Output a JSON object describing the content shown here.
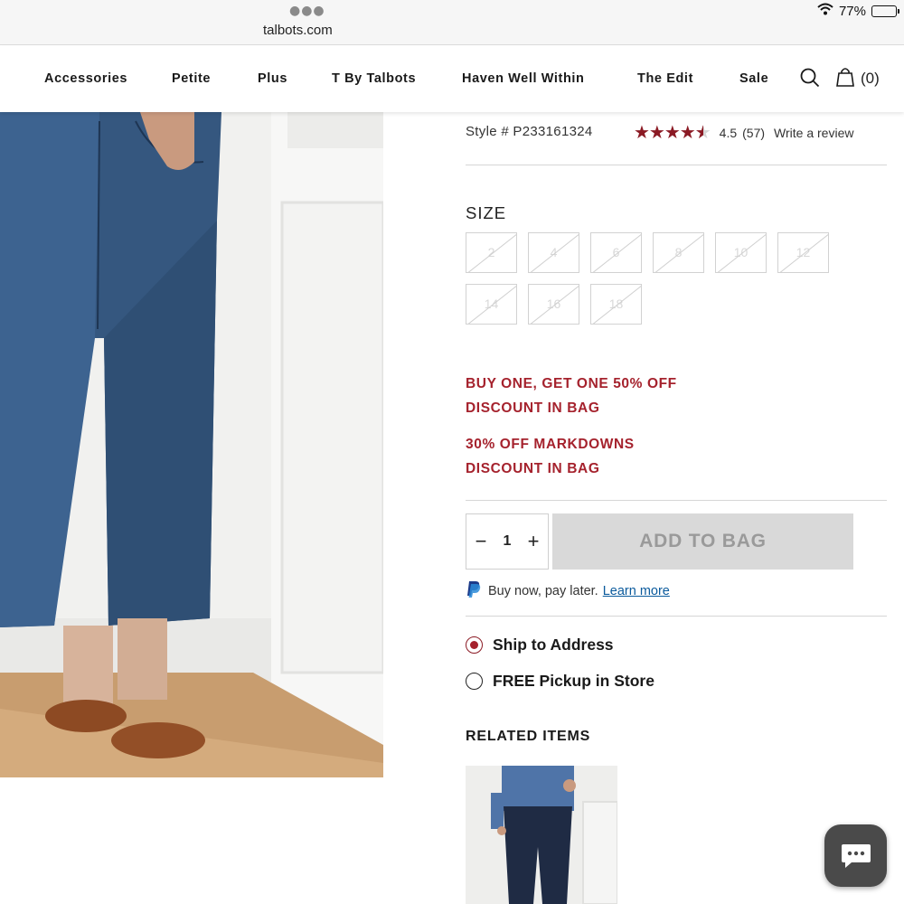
{
  "browser": {
    "url": "talbots.com",
    "battery_percent_label": "77%",
    "battery_level": 0.77
  },
  "nav": {
    "items": [
      "Accessories",
      "Petite",
      "Plus",
      "T By Talbots",
      "Haven Well Within",
      "The Edit",
      "Sale"
    ],
    "bag_count": "(0)"
  },
  "product": {
    "style": "Style # P233161324",
    "rating_value": "4.5",
    "rating_count": "(57)",
    "write_review": "Write a review",
    "stars_filled": 4.5,
    "size_label": "SIZE",
    "sizes": [
      "2",
      "4",
      "6",
      "8",
      "10",
      "12",
      "14",
      "16",
      "18"
    ],
    "sizes_available": false,
    "promos": [
      {
        "line1": "BUY ONE, GET ONE 50% OFF",
        "line2": "DISCOUNT IN BAG"
      },
      {
        "line1": "30% OFF MARKDOWNS",
        "line2": "DISCOUNT IN BAG"
      }
    ],
    "quantity": "1",
    "add_to_bag": "ADD TO BAG",
    "paypal_text": "Buy now, pay later.",
    "paypal_link": "Learn more",
    "ship_to_address": "Ship to Address",
    "pickup": "FREE Pickup in Store",
    "selected_fulfillment": "ship",
    "related_title": "RELATED ITEMS"
  },
  "colors": {
    "accent": "#a5222d",
    "button_disabled": "#d9d9d9",
    "link": "#0a5a9c"
  },
  "icons": [
    "wifi-icon",
    "battery-icon",
    "search-icon",
    "shopping-bag-icon",
    "star-icon",
    "paypal-icon",
    "chat-icon"
  ]
}
